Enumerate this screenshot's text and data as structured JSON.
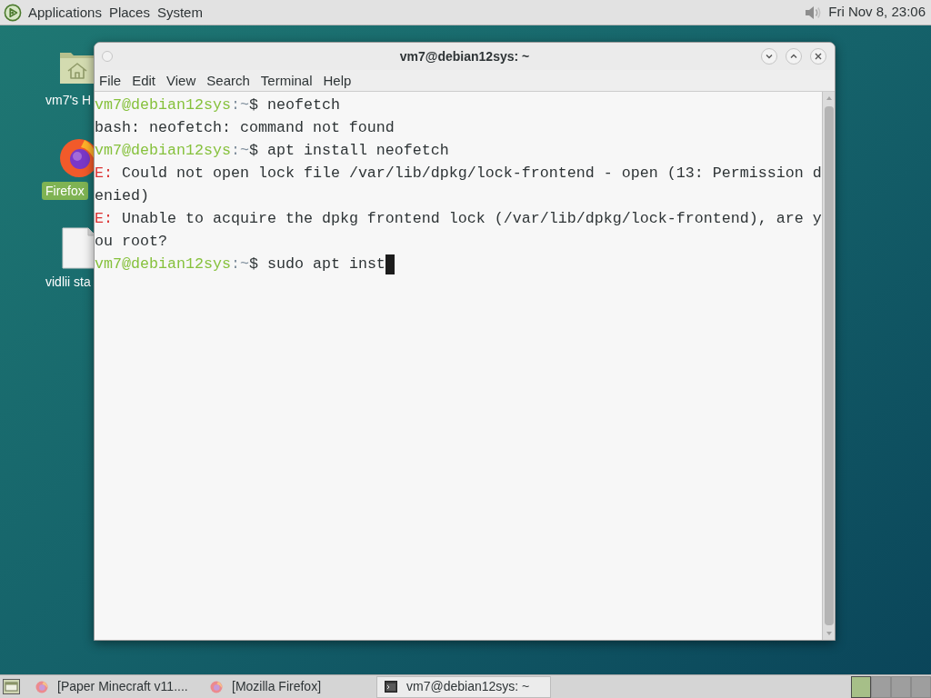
{
  "top_panel": {
    "menus": [
      "Applications",
      "Places",
      "System"
    ],
    "clock": "Fri Nov 8, 23:06"
  },
  "desktop_icons": [
    {
      "kind": "home",
      "label": "vm7's H",
      "selected": false
    },
    {
      "kind": "browser",
      "label": "Firefox",
      "selected": true
    },
    {
      "kind": "file",
      "label": "vidlii sta",
      "selected": false
    }
  ],
  "window": {
    "title": "vm7@debian12sys: ~",
    "menu": [
      "File",
      "Edit",
      "View",
      "Search",
      "Terminal",
      "Help"
    ],
    "lines": [
      {
        "cursor": false,
        "segments": [
          {
            "kind": "host",
            "text": "vm7@debian12sys"
          },
          {
            "kind": "path",
            "text": ":~"
          },
          {
            "kind": "plain",
            "text": "$ neofetch"
          }
        ]
      },
      {
        "cursor": false,
        "segments": [
          {
            "kind": "plain",
            "text": "bash: neofetch: command not found"
          }
        ]
      },
      {
        "cursor": false,
        "segments": [
          {
            "kind": "host",
            "text": "vm7@debian12sys"
          },
          {
            "kind": "path",
            "text": ":~"
          },
          {
            "kind": "plain",
            "text": "$ apt install neofetch"
          }
        ]
      },
      {
        "cursor": false,
        "segments": [
          {
            "kind": "error",
            "text": "E:"
          },
          {
            "kind": "plain",
            "text": " Could not open lock file /var/lib/dpkg/lock-frontend - open (13: Permission d"
          }
        ]
      },
      {
        "cursor": false,
        "segments": [
          {
            "kind": "plain",
            "text": "enied)"
          }
        ]
      },
      {
        "cursor": false,
        "segments": [
          {
            "kind": "error",
            "text": "E:"
          },
          {
            "kind": "plain",
            "text": " Unable to acquire the dpkg frontend lock (/var/lib/dpkg/lock-frontend), are y"
          }
        ]
      },
      {
        "cursor": false,
        "segments": [
          {
            "kind": "plain",
            "text": "ou root?"
          }
        ]
      },
      {
        "cursor": true,
        "segments": [
          {
            "kind": "host",
            "text": "vm7@debian12sys"
          },
          {
            "kind": "path",
            "text": ":~"
          },
          {
            "kind": "plain",
            "text": "$ sudo apt inst"
          }
        ]
      }
    ]
  },
  "taskbar": {
    "tasks": [
      {
        "kind": "browser",
        "label": "[Paper Minecraft v11....",
        "selected": false
      },
      {
        "kind": "browser",
        "label": "[Mozilla Firefox]",
        "selected": false
      },
      {
        "kind": "terminal",
        "label": "vm7@debian12sys: ~",
        "selected": true
      }
    ],
    "workspaces": [
      {
        "selected": true
      },
      {
        "selected": false
      },
      {
        "selected": false
      },
      {
        "selected": false
      }
    ]
  }
}
